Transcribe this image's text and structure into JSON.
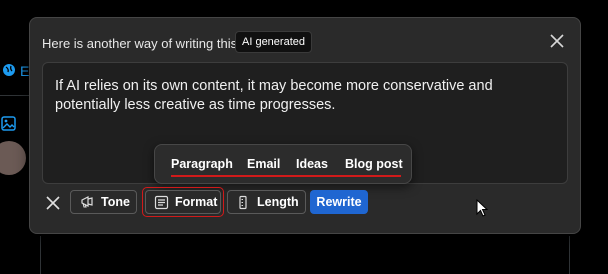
{
  "popup": {
    "header": "Here is another way of writing this",
    "badge": "AI generated",
    "body": "If AI relies on its own content, it may become more conservative and potentially less creative as time progresses."
  },
  "format_menu": {
    "items": [
      "Paragraph",
      "Email",
      "Ideas",
      "Blog post"
    ]
  },
  "toolbar": {
    "tone": "Tone",
    "format": "Format",
    "length": "Length",
    "rewrite": "Rewrite"
  },
  "left_nav": {
    "partial_label": "E"
  },
  "icons": [
    "close-icon",
    "megaphone-icon",
    "format-icon",
    "length-icon",
    "globe-icon",
    "image-icon",
    "mouse-cursor"
  ],
  "colors": {
    "accent": "#1f66d1",
    "highlight": "#d11a1a",
    "card_bg": "#2a2a2a"
  }
}
